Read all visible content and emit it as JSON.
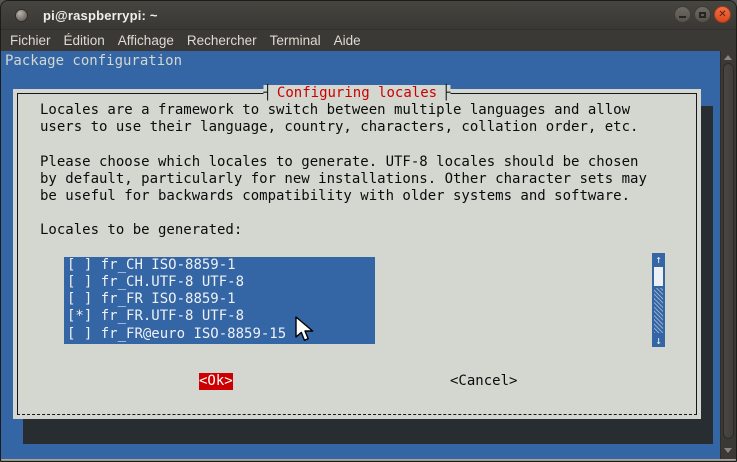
{
  "window": {
    "title": "pi@raspberrypi: ~",
    "controls": {
      "minimize": "minimize",
      "maximize": "maximize",
      "close": "close"
    }
  },
  "menubar": {
    "items": [
      "Fichier",
      "Édition",
      "Affichage",
      "Rechercher",
      "Terminal",
      "Aide"
    ]
  },
  "terminal": {
    "screen_title": "Package configuration"
  },
  "dialog": {
    "title": "Configuring locales",
    "paragraphs": [
      [
        "Locales are a framework to switch between multiple languages and allow",
        "users to use their language, country, characters, collation order, etc."
      ],
      [
        "Please choose which locales to generate. UTF-8 locales should be chosen",
        "by default, particularly for new installations. Other character sets may",
        "be useful for backwards compatibility with older systems and software."
      ]
    ],
    "list_label": "Locales to be generated:",
    "items": [
      {
        "state": "[ ]",
        "label": "fr_CH ISO-8859-1"
      },
      {
        "state": "[ ]",
        "label": "fr_CH.UTF-8 UTF-8"
      },
      {
        "state": "[ ]",
        "label": "fr_FR ISO-8859-1"
      },
      {
        "state": "[*]",
        "label": "fr_FR.UTF-8 UTF-8"
      },
      {
        "state": "[ ]",
        "label": "fr_FR@euro ISO-8859-15"
      }
    ],
    "scrollbar": {
      "up": "↑",
      "down": "↓"
    },
    "buttons": {
      "ok": "<Ok>",
      "cancel": "<Cancel>"
    }
  },
  "colors": {
    "screen_blue": "#3465A4",
    "dialog_gray": "#D3D7CF",
    "accent_red": "#CC0000",
    "shadow_dark": "#282D31",
    "chrome_dark": "#3A3835",
    "close_orange": "#DE5428"
  }
}
